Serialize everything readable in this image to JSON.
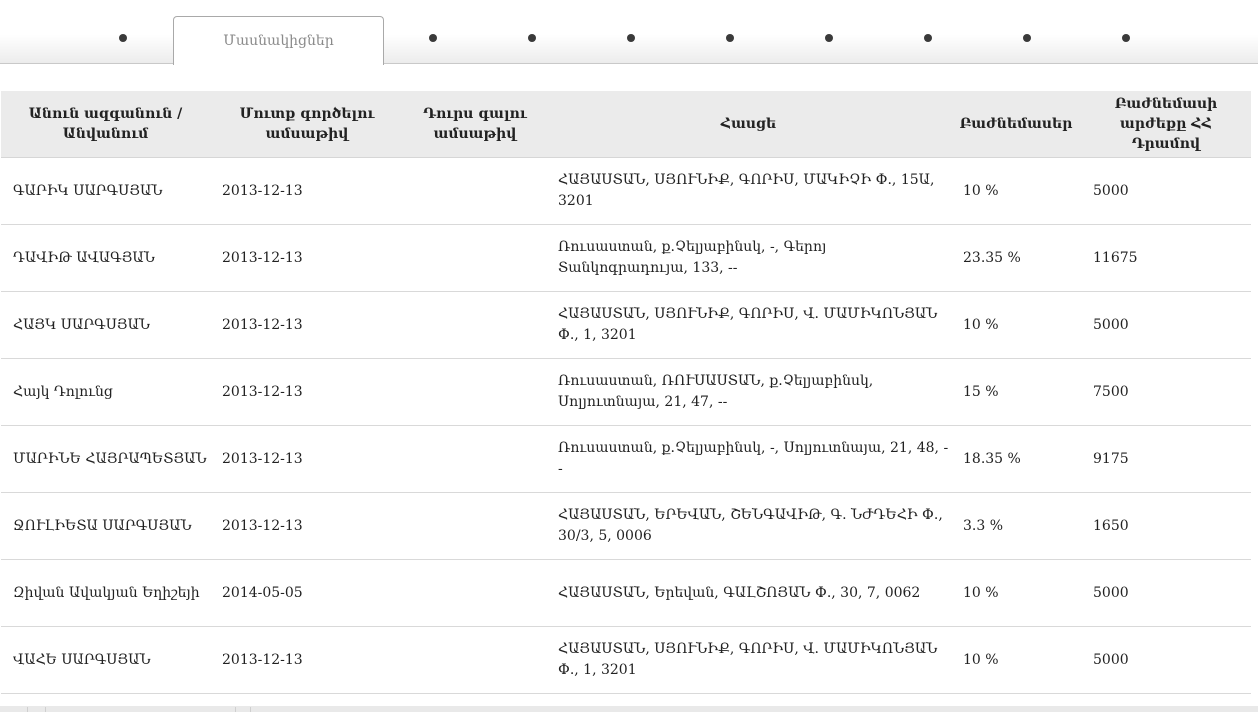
{
  "tabs": {
    "active_label": "Մասնակիցներ"
  },
  "table": {
    "headers": {
      "name": "Անուն ազգանուն / Անվանում",
      "entry_date": "Մուտք գործելու ամսաթիվ",
      "exit_date": "Դուրս գալու ամսաթիվ",
      "address": "Հասցե",
      "share": "Բաժնեմասեր",
      "share_value": "Բաժնեմասի արժեքը ՀՀ Դրամով"
    },
    "rows": [
      {
        "name": "ԳԱՐԻԿ ՍԱՐԳՍՅԱՆ",
        "entry_date": "2013-12-13",
        "exit_date": "",
        "address": "ՀԱՅԱՍՏԱՆ, ՍՅՈՒՆԻՔ, ԳՈՐԻՍ, ՄԱԿԻՉԻ Փ., 15Ա, 3201",
        "share": "10 %",
        "share_value": "5000"
      },
      {
        "name": "ԴԱՎԻԹ ԱՎԱԳՅԱՆ",
        "entry_date": "2013-12-13",
        "exit_date": "",
        "address": "Ռուսաստան, ք.Չելյաբինսկ, -, Գերոյ Տանկոգրադույա, 133, --",
        "share": "23.35 %",
        "share_value": "11675"
      },
      {
        "name": "ՀԱՅԿ ՍԱՐԳՍՅԱՆ",
        "entry_date": "2013-12-13",
        "exit_date": "",
        "address": "ՀԱՅԱՍՏԱՆ, ՍՅՈՒՆԻՔ, ԳՈՐԻՍ, Վ. ՄԱՄԻԿՈՆՅԱՆ Փ., 1, 3201",
        "share": "10 %",
        "share_value": "5000"
      },
      {
        "name": "Հայկ Դոլունց",
        "entry_date": "2013-12-13",
        "exit_date": "",
        "address": "Ռուսաստան, ՌՈՒՍԱՍՏԱՆ, ք.Չելյաբինսկ, Սոլյուտնայա, 21, 47, --",
        "share": "15 %",
        "share_value": "7500"
      },
      {
        "name": "ՄԱՐԻՆԵ ՀԱՅՐԱՊԵՏՅԱՆ",
        "entry_date": "2013-12-13",
        "exit_date": "",
        "address": "Ռուսաստան, ք.Չելյաբինսկ, -, Սոլյուտնայա, 21, 48, --",
        "share": "18.35 %",
        "share_value": "9175"
      },
      {
        "name": "ՋՈՒԼԻԵՏԱ ՍԱՐԳՍՅԱՆ",
        "entry_date": "2013-12-13",
        "exit_date": "",
        "address": "ՀԱՅԱՍՏԱՆ, ԵՐԵՎԱՆ, ՇԵՆԳԱՎԻԹ, Գ. ՆԺԴԵՀԻ Փ., 30/3, 5, 0006",
        "share": "3.3 %",
        "share_value": "1650"
      },
      {
        "name": "Զիվան Ավակյան Եղիշեյի",
        "entry_date": "2014-05-05",
        "exit_date": "",
        "address": "ՀԱՅԱՍՏԱՆ, Երեվան, ԳԱԼՇՈՅԱՆ Փ., 30, 7, 0062",
        "share": "10 %",
        "share_value": "5000"
      },
      {
        "name": "ՎԱՀԵ ՍԱՐԳՍՅԱՆ",
        "entry_date": "2013-12-13",
        "exit_date": "",
        "address": "ՀԱՅԱՍՏԱՆ, ՍՅՈՒՆԻՔ, ԳՈՐԻՍ, Վ. ՄԱՄԻԿՈՆՅԱՆ Փ., 1, 3201",
        "share": "10 %",
        "share_value": "5000"
      }
    ]
  }
}
